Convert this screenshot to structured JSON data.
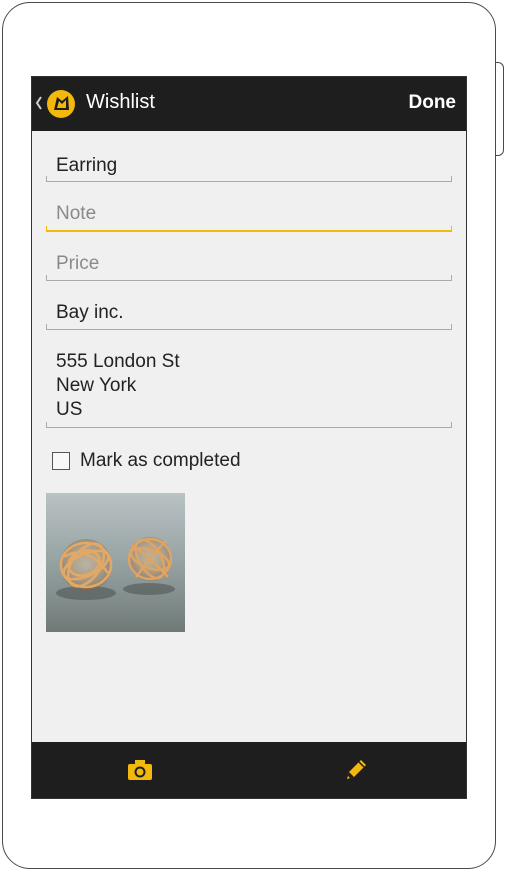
{
  "action_bar": {
    "title": "Wishlist",
    "done_label": "Done"
  },
  "form": {
    "name_value": "Earring",
    "note_placeholder": "Note",
    "price_placeholder": "Price",
    "store_value": "Bay inc.",
    "address_lines": [
      "555 London St",
      "New York",
      "US"
    ],
    "completed_label": "Mark as completed",
    "completed_checked": false
  },
  "bottom_bar": {
    "icons": [
      "camera-icon",
      "pencil-icon"
    ]
  },
  "colors": {
    "accent": "#f2b90c",
    "bar_background": "#1e1e1e",
    "screen_background": "#f0f0f0"
  }
}
